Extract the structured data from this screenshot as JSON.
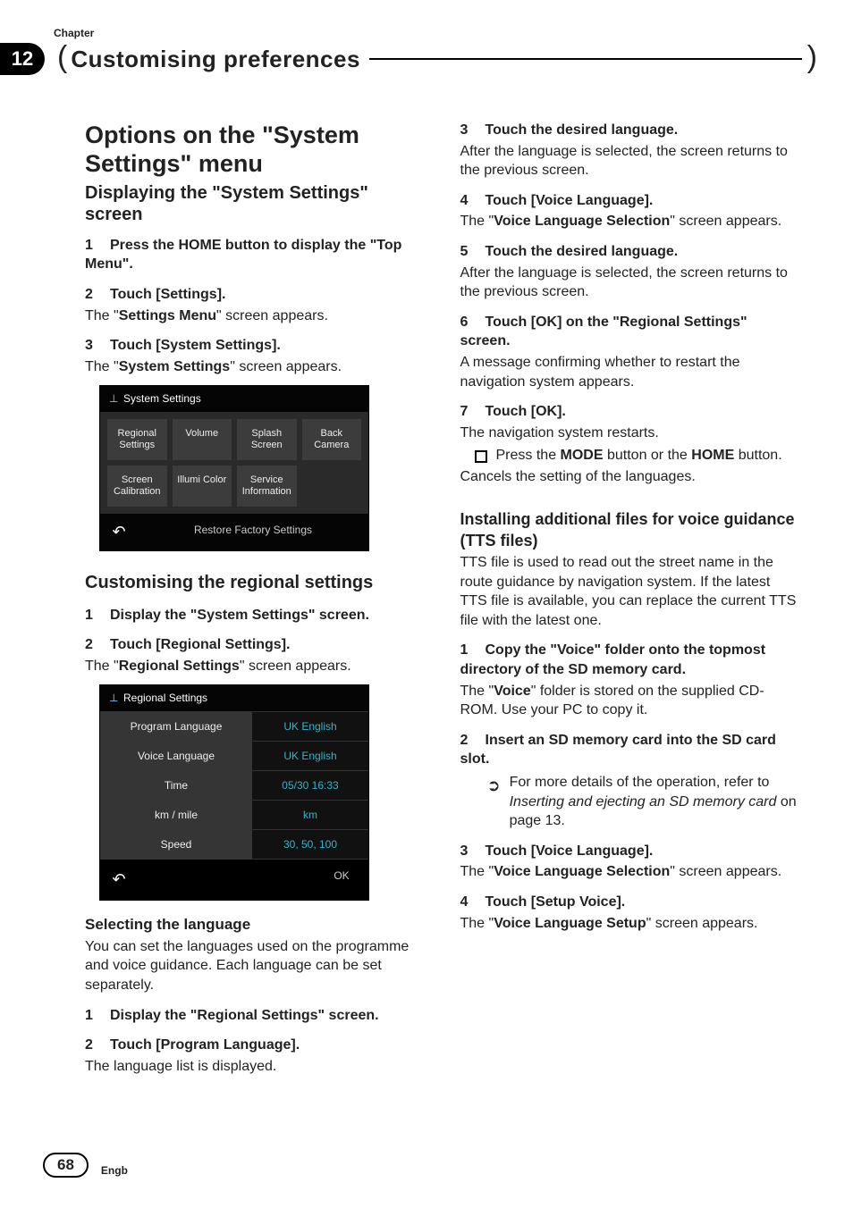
{
  "header": {
    "chapter_label": "Chapter",
    "chapter_number": "12",
    "title": "Customising preferences"
  },
  "left": {
    "h1_a": "Options on the ",
    "h1_b": "\"System Settings\"",
    "h1_c": " menu",
    "h2_a": "Displaying the ",
    "h2_b": "\"System Settings\"",
    "h2_c": " screen",
    "s1": "Press the HOME button to display the \"Top Menu\".",
    "s2": "Touch [Settings].",
    "s2_body_a": "The \"",
    "s2_body_b": "Settings Menu",
    "s2_body_c": "\" screen appears.",
    "s3": "Touch [System Settings].",
    "s3_body_a": "The \"",
    "s3_body_b": "System Settings",
    "s3_body_c": "\" screen appears.",
    "shot1": {
      "title": "System Settings",
      "cells": [
        "Regional Settings",
        "Volume",
        "Splash Screen",
        "Back Camera",
        "Screen Calibration",
        "Illumi Color",
        "Service Information"
      ],
      "restore": "Restore Factory Settings"
    },
    "h3_custom": "Customising the regional settings",
    "c1": "Display the \"System Settings\" screen.",
    "c2": "Touch [Regional Settings].",
    "c2_body_a": "The \"",
    "c2_body_b": "Regional Settings",
    "c2_body_c": "\" screen appears.",
    "shot2": {
      "title": "Regional Settings",
      "rows": [
        {
          "label": "Program Language",
          "value": "UK English"
        },
        {
          "label": "Voice Language",
          "value": "UK English"
        },
        {
          "label": "Time",
          "value": "05/30 16:33"
        },
        {
          "label": "km / mile",
          "value": "km"
        },
        {
          "label": "Speed",
          "value": "30, 50, 100"
        }
      ],
      "ok": "OK"
    },
    "h4_lang": "Selecting the language",
    "lang_intro": "You can set the languages used on the programme and voice guidance. Each language can be set separately.",
    "l1": "Display the \"Regional Settings\" screen.",
    "l2": "Touch [Program Language].",
    "l2_body": "The language list is displayed."
  },
  "right": {
    "r3": "Touch the desired language.",
    "r3_body": "After the language is selected, the screen returns to the previous screen.",
    "r4": "Touch [Voice Language].",
    "r4_body_a": "The \"",
    "r4_body_b": "Voice Language Selection",
    "r4_body_c": "\" screen appears.",
    "r5": "Touch the desired language.",
    "r5_body": "After the language is selected, the screen returns to the previous screen.",
    "r6": "Touch [OK] on the \"Regional Settings\" screen.",
    "r6_body": "A message confirming whether to restart the navigation system appears.",
    "r7": "Touch [OK].",
    "r7_body": "The navigation system restarts.",
    "r7_bullet_a": "Press the ",
    "r7_bullet_b": "MODE",
    "r7_bullet_c": " button or the ",
    "r7_bullet_d": "HOME",
    "r7_bullet_e": " button.",
    "r7_after": "Cancels the setting of the languages.",
    "tts_h": "Installing additional files for voice guidance (TTS files)",
    "tts_intro": "TTS file is used to read out the street name in the route guidance by navigation system. If the latest TTS file is available, you can replace the current TTS file with the latest one.",
    "t1": "Copy the \"Voice\" folder onto the topmost directory of the SD memory card.",
    "t1_body_a": "The \"",
    "t1_body_b": "Voice",
    "t1_body_c": "\" folder is stored on the supplied CD-ROM. Use your PC to copy it.",
    "t2": "Insert an SD memory card into the SD card slot.",
    "t2_bullet_a": "For more details of the operation, refer to ",
    "t2_bullet_b": "Inserting and ejecting an SD memory card",
    "t2_bullet_c": " on page 13.",
    "t3": "Touch [Voice Language].",
    "t3_body_a": "The \"",
    "t3_body_b": "Voice Language Selection",
    "t3_body_c": "\" screen appears.",
    "t4": "Touch [Setup Voice].",
    "t4_body_a": "The \"",
    "t4_body_b": "Voice Language Setup",
    "t4_body_c": "\" screen appears."
  },
  "footer": {
    "page": "68",
    "lang": "Engb"
  }
}
